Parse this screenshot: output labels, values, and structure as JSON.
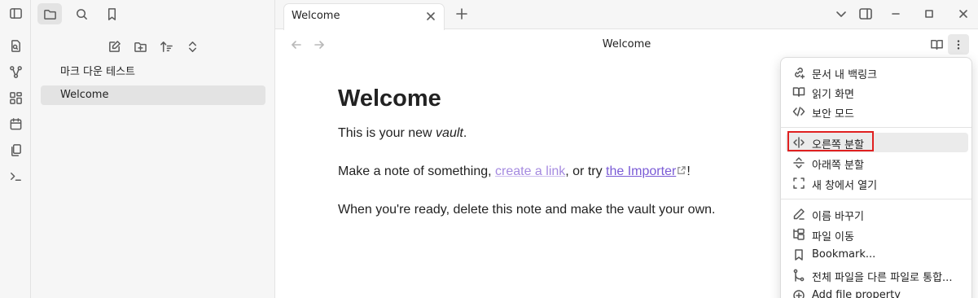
{
  "ribbon": {
    "icons": [
      "sidebar-toggle-icon",
      "open-quick-switcher-icon",
      "graph-view-icon",
      "canvas-icon",
      "daily-note-icon",
      "templates-icon",
      "command-palette-icon"
    ]
  },
  "explorer": {
    "tree": [
      {
        "label": "마크 다운 테스트",
        "selected": false
      },
      {
        "label": "Welcome",
        "selected": true
      }
    ]
  },
  "tabs": [
    {
      "title": "Welcome",
      "active": true
    }
  ],
  "view": {
    "title": "Welcome"
  },
  "note": {
    "heading": "Welcome",
    "p1_prefix": "This is your new ",
    "p1_em": "vault",
    "p1_suffix": ".",
    "p2_prefix": "Make a note of something, ",
    "p2_link": "create a link",
    "p2_mid": ", or try ",
    "p2_ext": "the Importer",
    "p2_suffix": "!",
    "p3": "When you're ready, delete this note and make the vault your own."
  },
  "menu": {
    "groups": [
      [
        {
          "icon": "backlinks-icon",
          "label": "문서 내 백링크"
        },
        {
          "icon": "book-open-icon",
          "label": "읽기 화면"
        },
        {
          "icon": "code-icon",
          "label": "보안 모드"
        }
      ],
      [
        {
          "icon": "split-right-icon",
          "label": "오른쪽 분할",
          "highlighted": true
        },
        {
          "icon": "split-down-icon",
          "label": "아래쪽 분할"
        },
        {
          "icon": "open-window-icon",
          "label": "새 창에서 열기"
        }
      ],
      [
        {
          "icon": "pencil-icon",
          "label": "이름 바꾸기"
        },
        {
          "icon": "move-file-icon",
          "label": "파일 이동"
        },
        {
          "icon": "bookmark-icon",
          "label": "Bookmark..."
        },
        {
          "icon": "merge-icon",
          "label": "전체 파일을 다른 파일로 통합..."
        },
        {
          "icon": "add-property-icon",
          "label": "Add file property"
        }
      ]
    ]
  },
  "colors": {
    "accent": "#7a5bd6",
    "internal_link": "#a58ae0",
    "highlight_border": "#e02020"
  }
}
